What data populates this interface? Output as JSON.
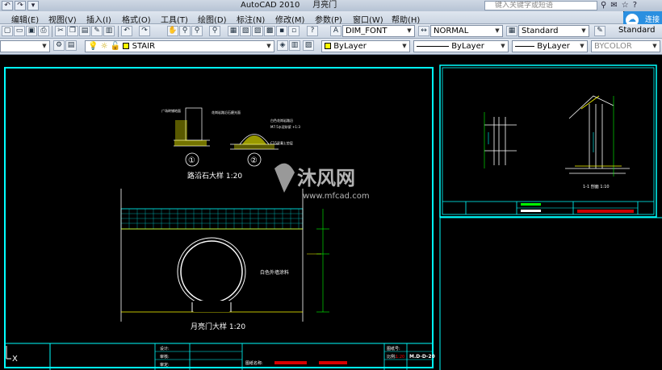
{
  "app": {
    "title": "AutoCAD 2010",
    "document": "月亮门",
    "search_placeholder": "键入关键字或短语"
  },
  "quick_access": [
    "↶",
    "↷",
    "▾"
  ],
  "cloud": {
    "label": "连接"
  },
  "menu": {
    "items": [
      "编辑(E)",
      "视图(V)",
      "插入(I)",
      "格式(O)",
      "工具(T)",
      "绘图(D)",
      "标注(N)",
      "修改(M)",
      "参数(P)",
      "窗口(W)",
      "帮助(H)"
    ]
  },
  "toolbar1": {
    "text_style": "DIM_FONT",
    "dim_style": "NORMAL",
    "table_style": "Standard",
    "multileader_style": "Standard"
  },
  "toolbar2": {
    "layer": "STAIR",
    "color": "ByLayer",
    "linetype": "ByLayer",
    "lineweight": "ByLayer",
    "plotstyle": "BYCOLOR"
  },
  "drawing": {
    "detail_title_1": "路沿石大样 1:20",
    "detail_title_2": "月亮门大样 1:20",
    "wall_note": "白色外墙涂料",
    "marker_1": "①",
    "marker_2": "②",
    "section_label": "1-1 剖面 1:10",
    "watermark_cn": "沐风网",
    "watermark_en": "www.mfcad.com",
    "titleblock": {
      "design": "设计:",
      "check": "审核:",
      "approve": "审定:",
      "sheet_no_label": "图纸号:",
      "scale_label": "比例:",
      "scale_value": "1:20",
      "drawing_no": "M.D-D-20",
      "project": "图纸名称:"
    }
  },
  "ucs": {
    "label": "X"
  },
  "colors": {
    "cyan": "#00ffff",
    "yellow": "#ffff00",
    "white": "#ffffff",
    "green": "#00ff00",
    "red": "#ff0000"
  }
}
